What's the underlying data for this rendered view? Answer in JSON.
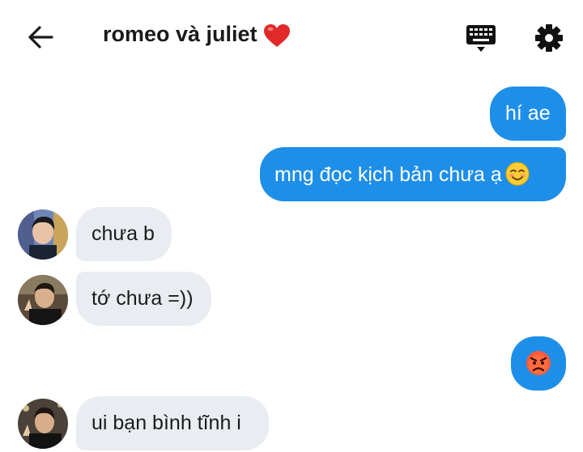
{
  "header": {
    "title": "romeo và juliet",
    "back_icon": "arrow-left-icon",
    "keyboard_icon": "keyboard-icon",
    "settings_icon": "gear-icon",
    "title_emoji": "red-heart-icon"
  },
  "colors": {
    "outgoing_bubble": "#1e8fe9",
    "incoming_bubble": "#e9edf2",
    "outgoing_text": "#ffffff",
    "incoming_text": "#1b1b1b"
  },
  "messages": [
    {
      "direction": "outgoing",
      "text": "hí ae"
    },
    {
      "direction": "outgoing",
      "text": "mng đọc kịch bản chưa ạ",
      "emoji": "smiling-face-icon"
    },
    {
      "direction": "incoming",
      "text": "chưa b",
      "avatar": "avatar-1"
    },
    {
      "direction": "incoming",
      "text": "tớ chưa =))",
      "avatar": "avatar-2"
    },
    {
      "direction": "outgoing",
      "text": "",
      "emoji": "angry-face-icon"
    },
    {
      "direction": "incoming",
      "text": "ui bạn bình tĩnh i",
      "avatar": "avatar-3"
    }
  ]
}
